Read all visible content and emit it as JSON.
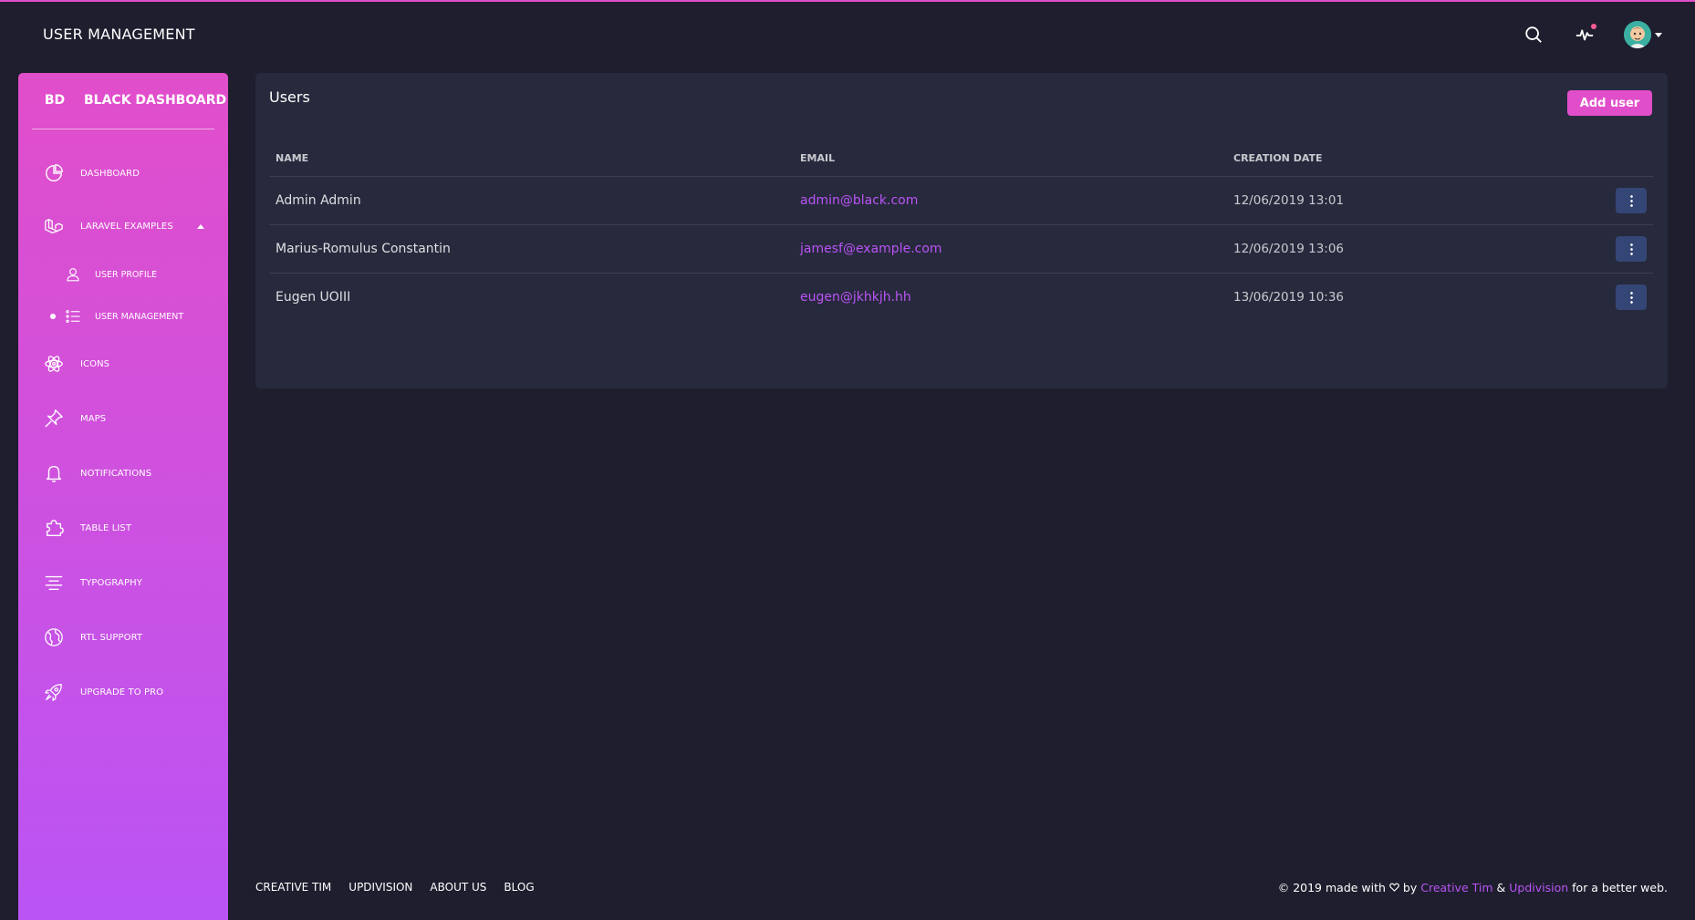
{
  "navbar": {
    "title": "USER MANAGEMENT",
    "icons": [
      "search-icon",
      "activity-icon",
      "avatar"
    ]
  },
  "sidebar": {
    "logo_mini": "BD",
    "logo_text": "BLACK DASHBOARD",
    "items": [
      {
        "label": "DASHBOARD",
        "icon": "chart-pie-icon"
      },
      {
        "label": "LARAVEL EXAMPLES",
        "icon": "laravel-icon"
      },
      {
        "label": "USER PROFILE",
        "icon": "user-icon"
      },
      {
        "label": "USER MANAGEMENT",
        "icon": "bullet-list-icon"
      },
      {
        "label": "ICONS",
        "icon": "atom-icon"
      },
      {
        "label": "MAPS",
        "icon": "pin-icon"
      },
      {
        "label": "NOTIFICATIONS",
        "icon": "bell-icon"
      },
      {
        "label": "TABLE LIST",
        "icon": "puzzle-icon"
      },
      {
        "label": "TYPOGRAPHY",
        "icon": "align-center-icon"
      },
      {
        "label": "RTL SUPPORT",
        "icon": "world-icon"
      },
      {
        "label": "UPGRADE TO PRO",
        "icon": "spaceship-icon"
      }
    ]
  },
  "card": {
    "title": "Users",
    "add_button": "Add user",
    "columns": [
      "NAME",
      "EMAIL",
      "CREATION DATE"
    ],
    "rows": [
      {
        "name": "Admin Admin",
        "email": "admin@black.com",
        "date": "12/06/2019 13:01"
      },
      {
        "name": "Marius-Romulus Constantin",
        "email": "jamesf@example.com",
        "date": "12/06/2019 13:06"
      },
      {
        "name": "Eugen UOIII",
        "email": "eugen@jkhkjh.hh",
        "date": "13/06/2019 10:36"
      }
    ]
  },
  "footer": {
    "links": [
      "CREATIVE TIM",
      "UPDIVISION",
      "ABOUT US",
      "BLOG"
    ],
    "copyright_prefix": "© 2019 made with",
    "copyright_by": "by",
    "author1": "Creative Tim",
    "amp": "&",
    "author2": "Updivision",
    "copyright_suffix": "for a better web."
  },
  "colors": {
    "accent": "#e14eca",
    "accent2": "#ba54f5",
    "background": "#1e1e2e",
    "card": "#27293d",
    "button_dark": "#344675"
  }
}
